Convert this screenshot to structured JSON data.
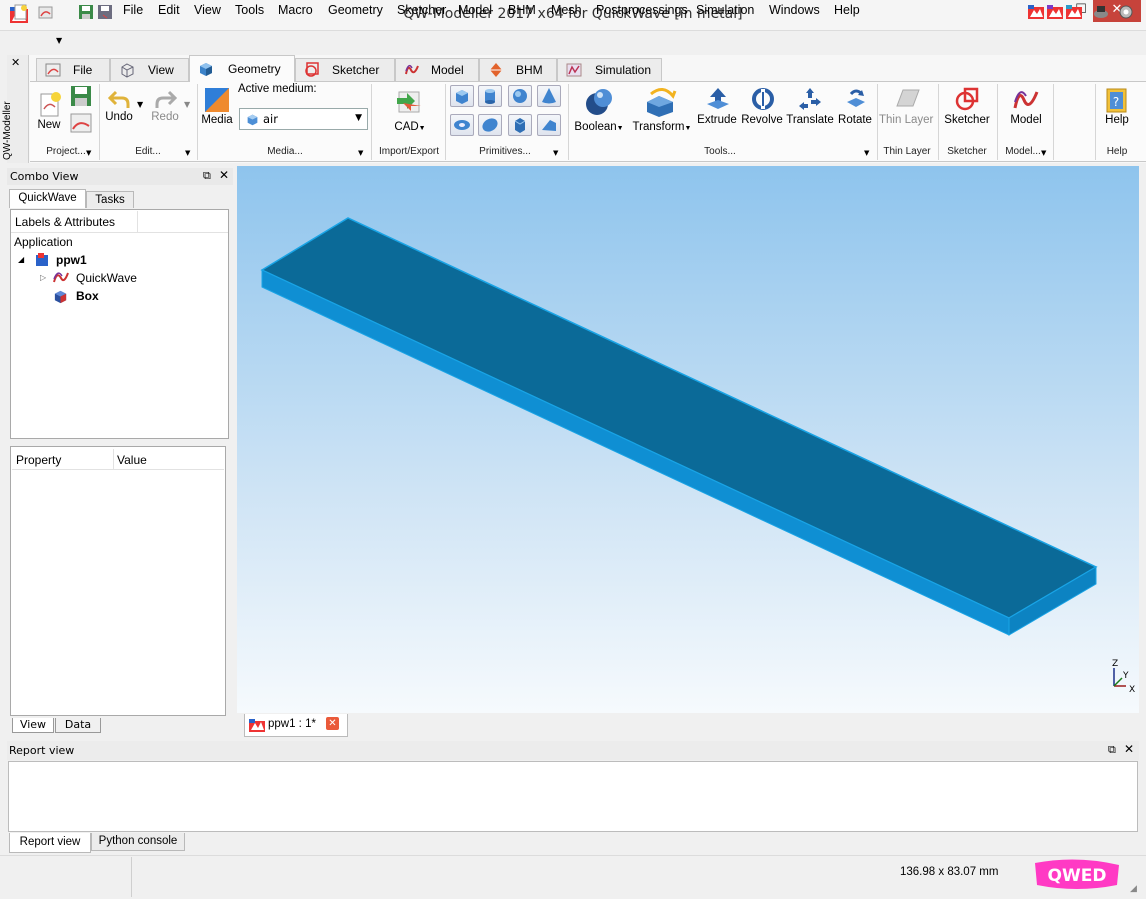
{
  "window": {
    "title": "QW-Modeller 2017 x64 for QuickWave [in metal]",
    "minimize": "—",
    "maximize": "☐",
    "close": "✕"
  },
  "menu": [
    "File",
    "Edit",
    "View",
    "Tools",
    "Macro",
    "Geometry",
    "Sketcher",
    "Model",
    "BHM",
    "Mesh",
    "Postprocessings",
    "Simulation",
    "Windows",
    "Help"
  ],
  "ribbon": {
    "side_label": "QW-Modeller",
    "side_close": "✕",
    "tabs": [
      {
        "label": "File",
        "icon": "file-tab-icon"
      },
      {
        "label": "View",
        "icon": "cube-outline-icon"
      },
      {
        "label": "Geometry",
        "icon": "geometry-cube-icon",
        "active": true
      },
      {
        "label": "Sketcher",
        "icon": "sketcher-icon"
      },
      {
        "label": "Model",
        "icon": "model-wave-icon"
      },
      {
        "label": "BHM",
        "icon": "bhm-icon"
      },
      {
        "label": "Simulation",
        "icon": "simulation-icon"
      }
    ],
    "project": {
      "new": "New",
      "group": "Project..."
    },
    "edit": {
      "undo": "Undo",
      "redo": "Redo",
      "group": "Edit..."
    },
    "media": {
      "media": "Media",
      "active_medium_label": "Active medium:",
      "active_medium_value": "air",
      "group": "Media..."
    },
    "import_export": {
      "cad": "CAD",
      "group": "Import/Export"
    },
    "primitives": {
      "group": "Primitives..."
    },
    "tools": {
      "boolean": "Boolean",
      "transform": "Transform",
      "extrude": "Extrude",
      "revolve": "Revolve",
      "translate": "Translate",
      "rotate": "Rotate",
      "group": "Tools..."
    },
    "thin_layer": {
      "button": "Thin Layer",
      "group": "Thin Layer"
    },
    "sketcher": {
      "button": "Sketcher",
      "group": "Sketcher"
    },
    "model": {
      "button": "Model",
      "group": "Model..."
    },
    "help": {
      "button": "Help",
      "group": "Help"
    }
  },
  "combo_view": {
    "title": "Combo View",
    "tabs": [
      "QuickWave",
      "Tasks"
    ],
    "tree_header": "Labels & Attributes",
    "application": "Application",
    "root": "ppw1",
    "children": [
      "QuickWave",
      "Box"
    ],
    "property_header": "Property",
    "value_header": "Value",
    "bottom_tabs": [
      "View",
      "Data"
    ]
  },
  "viewport": {
    "doc_tab": "ppw1 : 1*",
    "axis_labels": {
      "z": "Z",
      "y": "Y",
      "x": "X"
    },
    "shape_color": "#0b6a98"
  },
  "report": {
    "title": "Report view",
    "tabs": [
      "Report view",
      "Python console"
    ]
  },
  "status": {
    "dimensions": "136.98 x 83.07 mm",
    "logo": "QWED"
  }
}
